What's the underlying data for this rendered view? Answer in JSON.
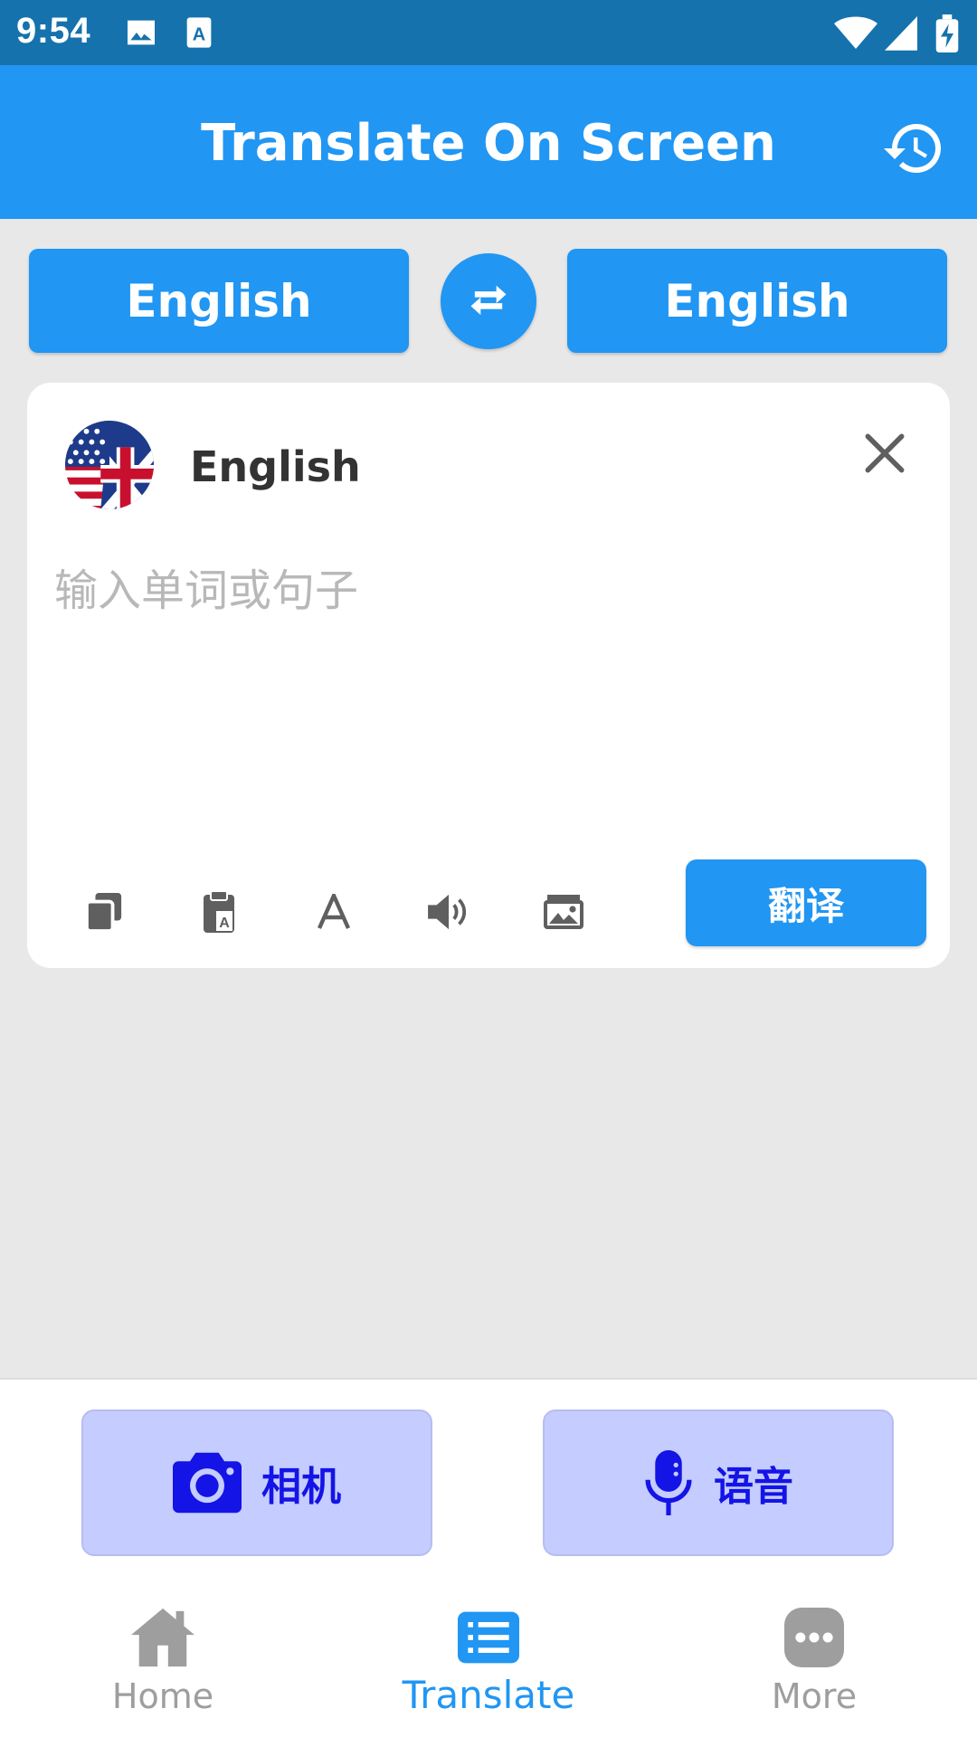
{
  "status_bar": {
    "time": "9:54",
    "icons": [
      "image-icon",
      "translate-app-icon",
      "wifi-icon",
      "signal-icon",
      "battery-charging-icon"
    ]
  },
  "app_bar": {
    "title": "Translate On Screen",
    "history_icon": "history-icon"
  },
  "language_selector": {
    "source_label": "English",
    "target_label": "English",
    "swap_icon": "swap-icon"
  },
  "input_card": {
    "language": "English",
    "flag_icon": "uk-us-flag-icon",
    "clear_icon": "close-icon",
    "placeholder": "输入单词或句子",
    "value": "",
    "tools": [
      "copy-icon",
      "paste-icon",
      "font-icon",
      "speaker-icon",
      "image-icon"
    ],
    "translate_label": "翻译"
  },
  "actions": {
    "camera_label": "相机",
    "voice_label": "语音"
  },
  "bottom_nav": {
    "items": [
      {
        "label": "Home",
        "icon": "home-icon",
        "active": false
      },
      {
        "label": "Translate",
        "icon": "translate-list-icon",
        "active": true
      },
      {
        "label": "More",
        "icon": "more-icon",
        "active": false
      }
    ]
  },
  "colors": {
    "status_bar": "#1672ad",
    "primary": "#2196f3",
    "background": "#e8e8e8",
    "action_button": "#c5ccff",
    "action_text": "#1414e6",
    "inactive_nav": "#9e9e9e"
  }
}
